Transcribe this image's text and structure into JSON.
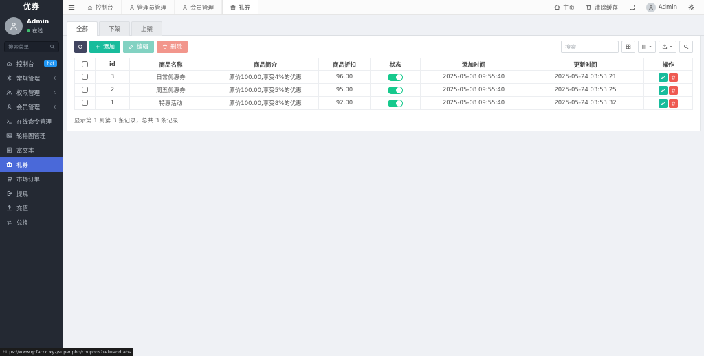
{
  "sidebar": {
    "title": "优券",
    "user": {
      "name": "Admin",
      "status": "在线"
    },
    "search_placeholder": "搜索菜单",
    "items": [
      {
        "label": "控制台",
        "icon": "dashboard-icon",
        "badge": "hot"
      },
      {
        "label": "常规管理",
        "icon": "gear-icon",
        "chevron": true
      },
      {
        "label": "权限管理",
        "icon": "users-icon",
        "chevron": true
      },
      {
        "label": "会员管理",
        "icon": "user-icon",
        "chevron": true
      },
      {
        "label": "在线命令管理",
        "icon": "terminal-icon"
      },
      {
        "label": "轮播图管理",
        "icon": "carousel-icon"
      },
      {
        "label": "富文本",
        "icon": "richtext-icon"
      },
      {
        "label": "礼券",
        "icon": "gift-icon",
        "active": true
      },
      {
        "label": "市场订单",
        "icon": "cart-icon"
      },
      {
        "label": "提现",
        "icon": "withdraw-icon"
      },
      {
        "label": "充值",
        "icon": "recharge-icon"
      },
      {
        "label": "兑换",
        "icon": "exchange-icon"
      }
    ]
  },
  "topbar": {
    "tabs": [
      {
        "label": "控制台",
        "icon": "dashboard-icon"
      },
      {
        "label": "管理员管理",
        "icon": "user-icon"
      },
      {
        "label": "会员管理",
        "icon": "user-icon"
      },
      {
        "label": "礼券",
        "icon": "gift-icon",
        "active": true
      }
    ],
    "right": {
      "home": "主页",
      "clear_cache": "清除缓存",
      "user": "Admin"
    }
  },
  "content": {
    "filter_tabs": [
      {
        "label": "全部",
        "active": true
      },
      {
        "label": "下架"
      },
      {
        "label": "上架"
      }
    ],
    "toolbar": {
      "add": "添加",
      "edit": "编辑",
      "delete": "删除",
      "search_placeholder": "搜索"
    },
    "table": {
      "columns": [
        "id",
        "商品名称",
        "商品简介",
        "商品折扣",
        "状态",
        "添加时间",
        "更新时间",
        "操作"
      ],
      "rows": [
        {
          "id": "3",
          "name": "日常优惠券",
          "intro": "原价100.00,享受4%的优惠",
          "discount": "96.00",
          "status": true,
          "created": "2025-05-08 09:55:40",
          "updated": "2025-05-24 03:53:21"
        },
        {
          "id": "2",
          "name": "周五优惠券",
          "intro": "原价100.00,享受5%的优惠",
          "discount": "95.00",
          "status": true,
          "created": "2025-05-08 09:55:40",
          "updated": "2025-05-24 03:53:25"
        },
        {
          "id": "1",
          "name": "特惠活动",
          "intro": "原价100.00,享受8%的优惠",
          "discount": "92.00",
          "status": true,
          "created": "2025-05-08 09:55:40",
          "updated": "2025-05-24 03:53:32"
        }
      ],
      "summary": "显示第 1 到第 3 条记录，总共 3 条记录"
    }
  },
  "statusbar": {
    "url": "https://www.qcfaccc.xyz/super.php/coupons?ref=addtabs"
  },
  "colors": {
    "sidebar_bg": "#242933",
    "active_item": "#4a69d9",
    "hot_badge": "#2196f3",
    "success": "#18bc9c",
    "danger": "#ee5a52",
    "toggle_on": "#16c98d",
    "refresh_btn": "#414560"
  }
}
